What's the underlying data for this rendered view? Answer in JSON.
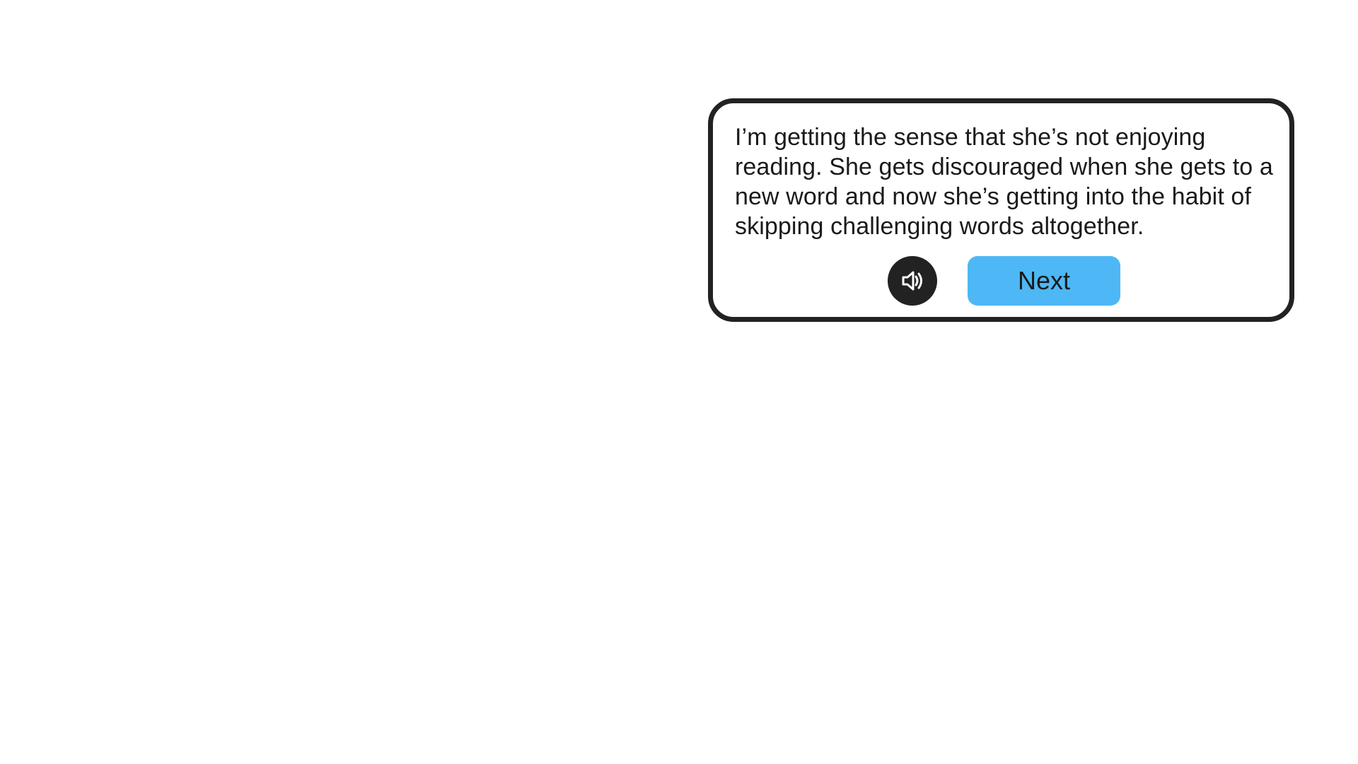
{
  "dialog": {
    "text": "I’m getting the sense that she’s not enjoying reading. She gets discouraged when she gets to a new word and now she’s getting into the habit of skipping challenging words altogether.",
    "audio_icon": "speaker-icon",
    "next_label": "Next"
  },
  "colors": {
    "border": "#222222",
    "next_button": "#4db8f5",
    "audio_button": "#222222",
    "text": "#1a1a1a"
  }
}
